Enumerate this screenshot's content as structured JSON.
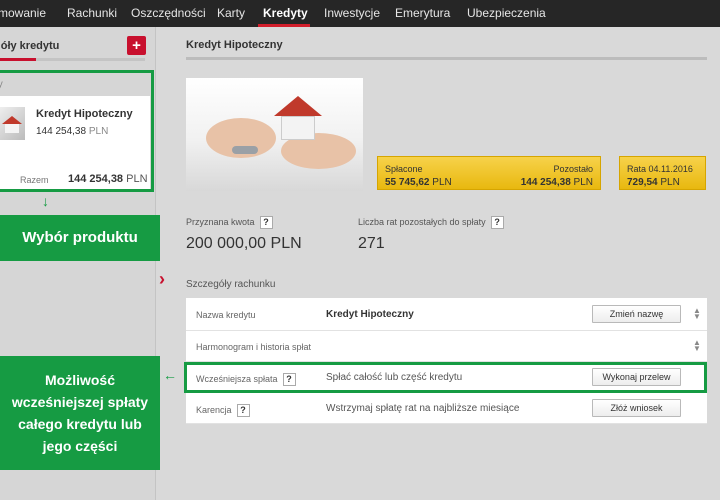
{
  "nav": {
    "items": [
      {
        "label": "mowanie",
        "key": "nav-item-planowanie"
      },
      {
        "label": "Rachunki",
        "key": "nav-item-rachunki"
      },
      {
        "label": "Oszczędności",
        "key": "nav-item-oszczednosci"
      },
      {
        "label": "Karty",
        "key": "nav-item-karty"
      },
      {
        "label": "Kredyty",
        "key": "nav-item-kredyty"
      },
      {
        "label": "Inwestycje",
        "key": "nav-item-inwestycje"
      },
      {
        "label": "Emerytura",
        "key": "nav-item-emerytura"
      },
      {
        "label": "Ubezpieczenia",
        "key": "nav-item-ubezpieczenia"
      }
    ],
    "active": "Kredyty"
  },
  "sidebar": {
    "title": "góły kredytu",
    "plus_label": "+",
    "section_label": "ty",
    "product": {
      "name": "Kredyt Hipoteczny",
      "amount": "144 254,38",
      "currency": "PLN"
    },
    "total": {
      "label": "Razem",
      "amount": "144 254,38",
      "currency": "PLN"
    }
  },
  "annotations": {
    "product_choice": "Wybór produktu",
    "early_repayment": [
      "Możliwość",
      "wcześniejszej spłaty",
      "całego kredytu lub",
      "jego części"
    ]
  },
  "main": {
    "title": "Kredyt Hipoteczny",
    "summary": {
      "repaid_label": "Spłacone",
      "repaid_value": "55 745,62",
      "remaining_label": "Pozostało",
      "remaining_value": "144 254,38",
      "installment_label": "Rata 04.11.2016",
      "installment_value": "729,54",
      "currency": "PLN"
    },
    "granted_label": "Przyznana kwota",
    "granted_value": "200 000,00 PLN",
    "installments_left_label": "Liczba rat pozostałych do spłaty",
    "installments_left_value": "271",
    "details_title": "Szczegóły rachunku",
    "help_label": "?",
    "rows": {
      "name_label": "Nazwa kredytu",
      "name_value": "Kredyt Hipoteczny",
      "rename_button": "Zmień nazwę",
      "schedule_label": "Harmonogram i historia spłat",
      "early_label": "Wcześniejsza spłata",
      "early_value": "Spłać całość lub część kredytu",
      "transfer_button": "Wykonaj przelew",
      "grace_label": "Karencja",
      "grace_value": "Wstrzymaj spłatę rat na najbliższe miesiące",
      "application_button": "Złóż wniosek"
    }
  },
  "colors": {
    "accent_red": "#c8102e",
    "annotation_green": "#169b43",
    "summary_yellow": "#f0c52a"
  }
}
